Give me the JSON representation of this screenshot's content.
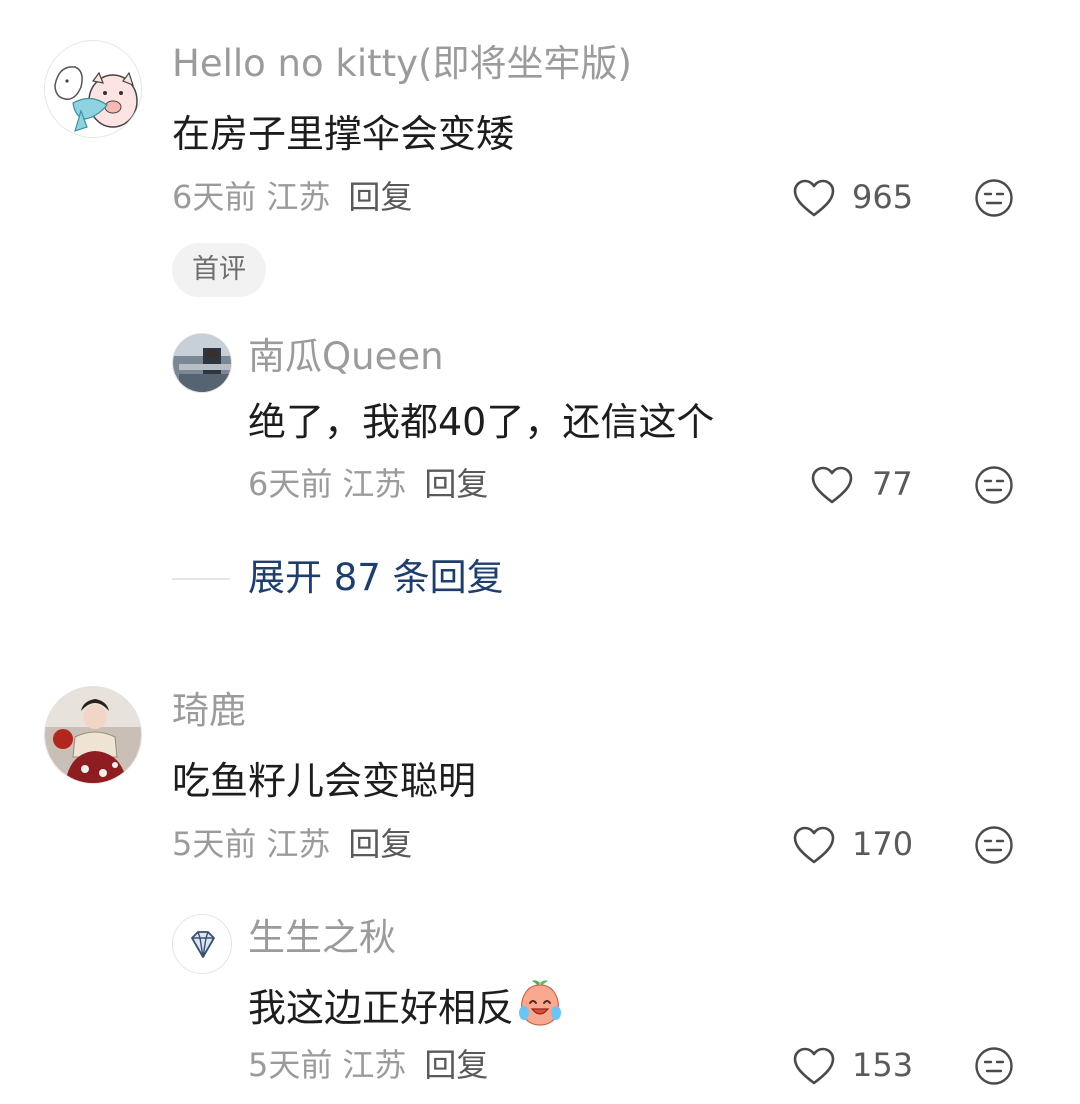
{
  "comments": [
    {
      "user": "Hello no kitty(即将坐牢版)",
      "avatar_icon": "pig-cartoon-avatar",
      "text": "在房子里撑伞会变矮",
      "time": "6天前",
      "location": "江苏",
      "reply_label": "回复",
      "likes": "965",
      "badge": "首评",
      "replies": [
        {
          "user": "南瓜Queen",
          "avatar_icon": "photo-avatar",
          "text": "绝了，我都40了，还信这个",
          "time": "6天前",
          "location": "江苏",
          "reply_label": "回复",
          "likes": "77"
        }
      ],
      "expand_label": "展开 87 条回复"
    },
    {
      "user": "琦鹿",
      "avatar_icon": "portrait-avatar",
      "text": "吃鱼籽儿会变聪明",
      "time": "5天前",
      "location": "江苏",
      "reply_label": "回复",
      "likes": "170",
      "replies": [
        {
          "user": "生生之秋",
          "avatar_icon": "diamond-avatar",
          "text": "我这边正好相反",
          "emoji": "crying-laughing-emoji",
          "time": "5天前",
          "location": "江苏",
          "reply_label": "回复",
          "likes": "153"
        }
      ]
    }
  ],
  "colors": {
    "name": "#9b9b9b",
    "text": "#1d1d1d",
    "expand_link": "#1e3f6e"
  }
}
